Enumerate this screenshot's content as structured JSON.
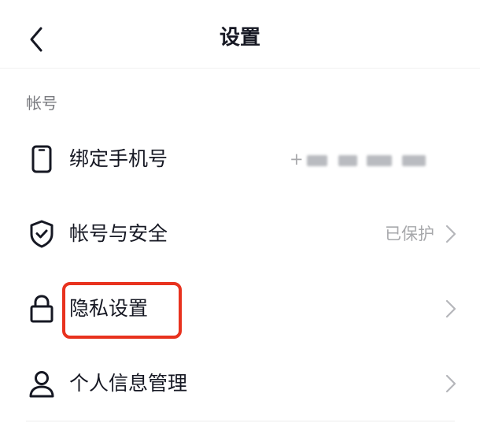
{
  "header": {
    "title": "设置",
    "back_icon": "chevron-left-icon"
  },
  "section": {
    "label": "帐号"
  },
  "rows": [
    {
      "icon": "phone-icon",
      "label": "绑定手机号",
      "value": "+"
    },
    {
      "icon": "shield-check-icon",
      "label": "帐号与安全",
      "value": "已保护"
    },
    {
      "icon": "lock-icon",
      "label": "隐私设置",
      "value": ""
    },
    {
      "icon": "user-icon",
      "label": "个人信息管理",
      "value": ""
    }
  ],
  "colors": {
    "highlight": "#e8321e",
    "text_primary": "#161823",
    "text_secondary": "#a7a8ab"
  }
}
